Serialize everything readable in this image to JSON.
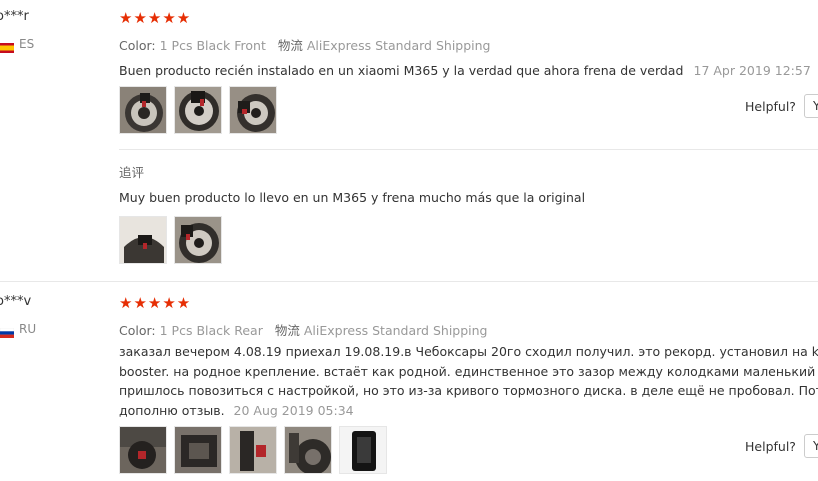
{
  "reviews": [
    {
      "user": "o***r",
      "country": "ES",
      "stars": "★★★★★",
      "color_label": "Color:",
      "color_value": "1 Pcs Black Front",
      "shipping_label": "物流",
      "shipping_value": "AliExpress Standard Shipping",
      "text": "Buen producto recién instalado en un xiaomi M365 y la verdad que ahora frena de verdad",
      "date": "17 Apr 2019 12:57",
      "helpful_label": "Helpful?",
      "yes_label": "Y",
      "append": {
        "label": "追评",
        "text": "Muy buen producto lo llevo en un M365 y frena mucho más que la original"
      }
    },
    {
      "user": "o***v",
      "country": "RU",
      "stars": "★★★★★",
      "color_label": "Color:",
      "color_value": "1 Pcs Black Rear",
      "shipping_label": "物流",
      "shipping_value": "AliExpress Standard Shipping",
      "text_lines": [
        "заказал вечером 4.08.19 приехал 19.08.19.в Чебоксары 20го сходил получил. это рекорд. установил на kugoo g",
        "booster. на родное крепление. встаёт как родной. единственное это зазор между колодками маленький очень",
        "пришлось повозиться с настройкой, но это из-за кривого тормозного диска. в деле ещё не пробовал. Потом",
        "дополню отзыв."
      ],
      "date": "20 Aug 2019 05:34",
      "helpful_label": "Helpful?",
      "yes_label": "Y"
    }
  ],
  "colors": {
    "star": "#e62e04",
    "flag_es_red": "#c60b1e",
    "flag_es_yellow": "#ffc400",
    "flag_ru_blue": "#0039a6",
    "flag_ru_red": "#d52b1e"
  }
}
